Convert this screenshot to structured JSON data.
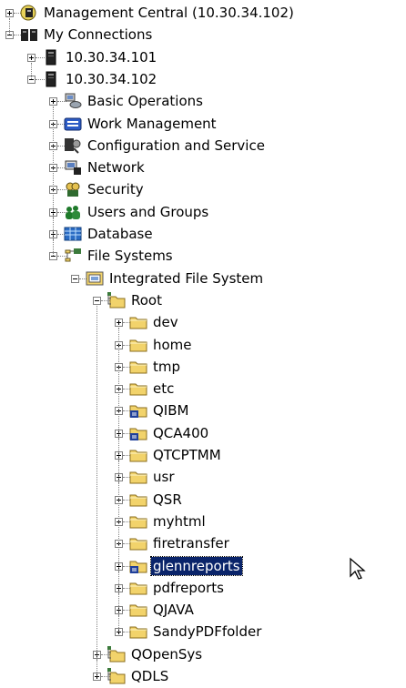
{
  "tree": [
    {
      "id": "mgmt",
      "label": "Management Central (10.30.34.102)",
      "icon": "management-central-icon",
      "expander": "plus",
      "depth": 0
    },
    {
      "id": "myconn",
      "label": "My Connections",
      "icon": "connections-icon",
      "expander": "minus",
      "depth": 0
    },
    {
      "id": "sys101",
      "label": "10.30.34.101",
      "icon": "system-icon",
      "expander": "plus",
      "depth": 1
    },
    {
      "id": "sys102",
      "label": "10.30.34.102",
      "icon": "system-icon",
      "expander": "minus",
      "depth": 1
    },
    {
      "id": "basicops",
      "label": "Basic Operations",
      "icon": "basic-operations-icon",
      "expander": "plus",
      "depth": 2
    },
    {
      "id": "workmgmt",
      "label": "Work Management",
      "icon": "work-management-icon",
      "expander": "plus",
      "depth": 2
    },
    {
      "id": "config",
      "label": "Configuration and Service",
      "icon": "configuration-icon",
      "expander": "plus",
      "depth": 2
    },
    {
      "id": "network",
      "label": "Network",
      "icon": "network-icon",
      "expander": "plus",
      "depth": 2
    },
    {
      "id": "security",
      "label": "Security",
      "icon": "security-icon",
      "expander": "plus",
      "depth": 2
    },
    {
      "id": "users",
      "label": "Users and Groups",
      "icon": "users-groups-icon",
      "expander": "plus",
      "depth": 2
    },
    {
      "id": "database",
      "label": "Database",
      "icon": "database-icon",
      "expander": "plus",
      "depth": 2
    },
    {
      "id": "filesys",
      "label": "File Systems",
      "icon": "file-systems-icon",
      "expander": "minus",
      "depth": 2
    },
    {
      "id": "ifs",
      "label": "Integrated File System",
      "icon": "ifs-icon",
      "expander": "minus",
      "depth": 3
    },
    {
      "id": "root",
      "label": "Root",
      "icon": "root-icon",
      "expander": "minus",
      "depth": 4
    },
    {
      "id": "dev",
      "label": "dev",
      "icon": "folder-icon",
      "expander": "plus",
      "depth": 5
    },
    {
      "id": "home",
      "label": "home",
      "icon": "folder-icon",
      "expander": "plus",
      "depth": 5
    },
    {
      "id": "tmp",
      "label": "tmp",
      "icon": "folder-icon",
      "expander": "plus",
      "depth": 5
    },
    {
      "id": "etc",
      "label": "etc",
      "icon": "folder-icon",
      "expander": "plus",
      "depth": 5
    },
    {
      "id": "qibm",
      "label": "QIBM",
      "icon": "shared-folder-icon",
      "expander": "plus",
      "depth": 5
    },
    {
      "id": "qca400",
      "label": "QCA400",
      "icon": "shared-folder-icon",
      "expander": "plus",
      "depth": 5
    },
    {
      "id": "qtcptmm",
      "label": "QTCPTMM",
      "icon": "folder-icon",
      "expander": "plus",
      "depth": 5
    },
    {
      "id": "usr",
      "label": "usr",
      "icon": "folder-icon",
      "expander": "plus",
      "depth": 5
    },
    {
      "id": "qsr",
      "label": "QSR",
      "icon": "folder-icon",
      "expander": "plus",
      "depth": 5
    },
    {
      "id": "myhtml",
      "label": "myhtml",
      "icon": "folder-icon",
      "expander": "plus",
      "depth": 5
    },
    {
      "id": "firetransfer",
      "label": "firetransfer",
      "icon": "folder-icon",
      "expander": "plus",
      "depth": 5
    },
    {
      "id": "glennreports",
      "label": "glennreports",
      "icon": "shared-folder-icon",
      "expander": "plus",
      "depth": 5,
      "selected": true
    },
    {
      "id": "pdfreports",
      "label": "pdfreports",
      "icon": "folder-icon",
      "expander": "plus",
      "depth": 5
    },
    {
      "id": "qjava",
      "label": "QJAVA",
      "icon": "folder-icon",
      "expander": "plus",
      "depth": 5
    },
    {
      "id": "sandypdf",
      "label": "SandyPDFfolder",
      "icon": "folder-icon",
      "expander": "plus",
      "depth": 5
    },
    {
      "id": "qopensys",
      "label": "QOpenSys",
      "icon": "root-icon",
      "expander": "plus",
      "depth": 4
    },
    {
      "id": "qdls",
      "label": "QDLS",
      "icon": "root-icon",
      "expander": "plus",
      "depth": 4
    }
  ],
  "colors": {
    "selection_bg": "#0a246a",
    "folder_yellow": "#f2d36b",
    "shared_blue": "#1f3f9a"
  }
}
